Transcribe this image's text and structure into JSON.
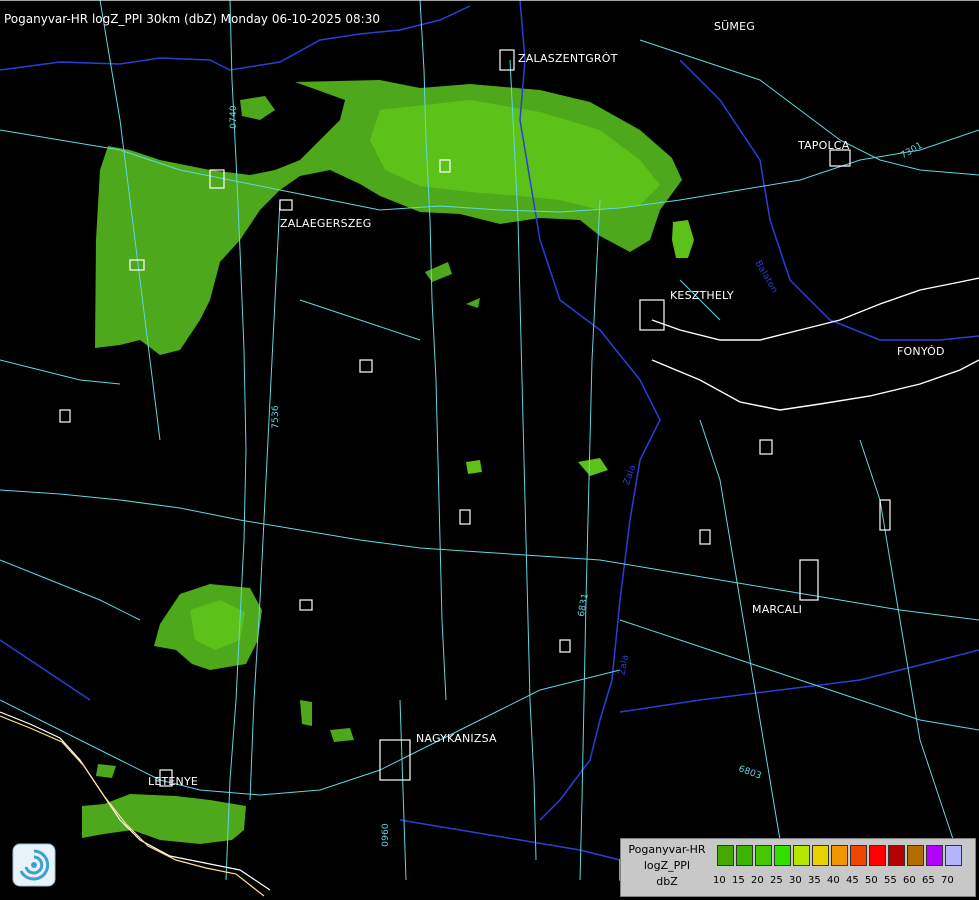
{
  "title": "Poganyvar-HR logZ_PPI 30km (dbZ) Monday 06-10-2025 08:30",
  "cities": [
    {
      "name": "SÜMEG",
      "key": "sumeg"
    },
    {
      "name": "ZALASZENTGRÓT",
      "key": "zalaszentgrot"
    },
    {
      "name": "TAPOLCA",
      "key": "tapolca"
    },
    {
      "name": "ZALAEGERSZEG",
      "key": "zalaegerszeg"
    },
    {
      "name": "KESZTHELY",
      "key": "keszthely"
    },
    {
      "name": "FONYÓD",
      "key": "fonyod"
    },
    {
      "name": "MARCALI",
      "key": "marcali"
    },
    {
      "name": "NAGYKANIZSA",
      "key": "nagykanizsa"
    },
    {
      "name": "LETENYE",
      "key": "letenye"
    }
  ],
  "road_labels": [
    "0740",
    "7301",
    "7536",
    "6831",
    "6803",
    "0960"
  ],
  "river_labels": [
    "Zala",
    "Balaton",
    "Zala"
  ],
  "legend": {
    "line1": "Poganyvar-HR",
    "line2": "logZ_PPI",
    "line3": "dbZ",
    "levels": [
      "10",
      "15",
      "20",
      "25",
      "30",
      "35",
      "40",
      "45",
      "50",
      "55",
      "60",
      "65",
      "70"
    ],
    "colors": [
      "#46a800",
      "#3cb400",
      "#46c800",
      "#32e000",
      "#b4e600",
      "#e6d200",
      "#f09600",
      "#f04600",
      "#ff0000",
      "#b40000",
      "#b46e00",
      "#b400ff",
      "#b4b4ff"
    ]
  },
  "colors": {
    "echo_weak": "#4da81c",
    "echo_mid": "#5cc21a",
    "roads": "#5fd7e0",
    "rivers": "#2a3fd8",
    "borders": "#ffffff"
  }
}
